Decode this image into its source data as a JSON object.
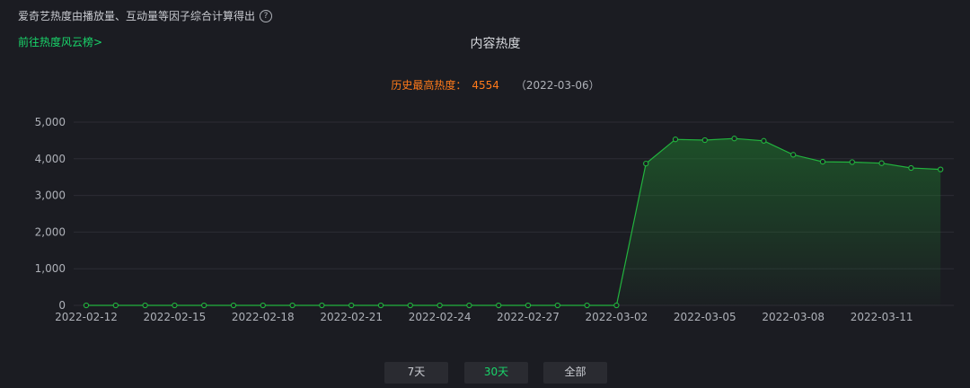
{
  "header": {
    "description": "爱奇艺热度由播放量、互动量等因子综合计算得出",
    "help_icon": "question-circle-icon",
    "rank_link": "前往热度风云榜>"
  },
  "peak": {
    "label": "历史最高热度：",
    "value": "4554",
    "date": "（2022-03-06）"
  },
  "tabs": [
    {
      "label": "7天",
      "active": false
    },
    {
      "label": "30天",
      "active": true
    },
    {
      "label": "全部",
      "active": false
    }
  ],
  "colors": {
    "line": "#22b33e",
    "accent_green": "#19d46a",
    "peak_orange": "#ff7a1a",
    "background": "#1b1c22"
  },
  "chart_data": {
    "type": "area",
    "title": "内容热度",
    "xlabel": "",
    "ylabel": "",
    "ylim": [
      0,
      5000
    ],
    "yticks": [
      0,
      1000,
      2000,
      3000,
      4000,
      5000
    ],
    "ytick_labels": [
      "0",
      "1,000",
      "2,000",
      "3,000",
      "4,000",
      "5,000"
    ],
    "x": [
      "2022-02-12",
      "2022-02-13",
      "2022-02-14",
      "2022-02-15",
      "2022-02-16",
      "2022-02-17",
      "2022-02-18",
      "2022-02-19",
      "2022-02-20",
      "2022-02-21",
      "2022-02-22",
      "2022-02-23",
      "2022-02-24",
      "2022-02-25",
      "2022-02-26",
      "2022-02-27",
      "2022-02-28",
      "2022-03-01",
      "2022-03-02",
      "2022-03-03",
      "2022-03-04",
      "2022-03-05",
      "2022-03-06",
      "2022-03-07",
      "2022-03-08",
      "2022-03-09",
      "2022-03-10",
      "2022-03-11",
      "2022-03-12",
      "2022-03-13"
    ],
    "xtick_labels": [
      "2022-02-12",
      "2022-02-15",
      "2022-02-18",
      "2022-02-21",
      "2022-02-24",
      "2022-02-27",
      "2022-03-02",
      "2022-03-05",
      "2022-03-08",
      "2022-03-11"
    ],
    "values": [
      0,
      0,
      0,
      0,
      0,
      0,
      0,
      0,
      0,
      0,
      0,
      0,
      0,
      0,
      0,
      0,
      0,
      0,
      0,
      3870,
      4530,
      4510,
      4554,
      4490,
      4110,
      3920,
      3910,
      3880,
      3750,
      3710
    ],
    "grid": true
  }
}
